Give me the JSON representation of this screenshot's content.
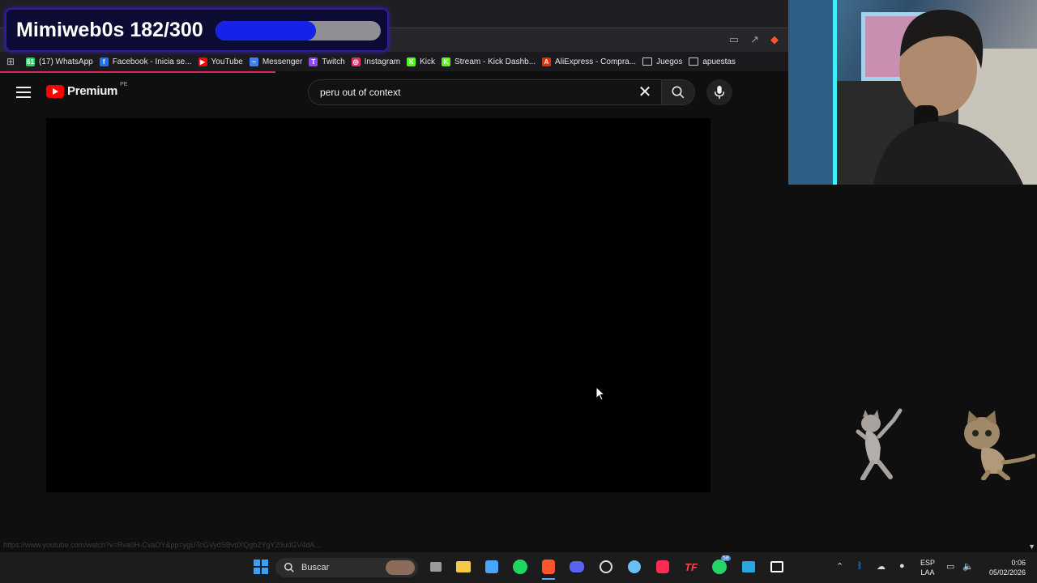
{
  "overlay": {
    "goal_text": "Mimiweb0s 182/300",
    "goal_progress": 0.607,
    "fill_color": "#1522e8"
  },
  "bookmarks": [
    {
      "label": "(17) WhatsApp",
      "icon": "whatsapp-icon",
      "color": "#25d366",
      "badge": "61"
    },
    {
      "label": "Facebook - Inicia se...",
      "icon": "facebook-icon",
      "color": "#1877f2",
      "badge": "f"
    },
    {
      "label": "YouTube",
      "icon": "youtube-icon",
      "color": "#ff0000",
      "badge": "▶"
    },
    {
      "label": "Messenger",
      "icon": "messenger-icon",
      "color": "#3b82f6",
      "badge": "~"
    },
    {
      "label": "Twitch",
      "icon": "twitch-icon",
      "color": "#9146ff",
      "badge": "T"
    },
    {
      "label": "Instagram",
      "icon": "instagram-icon",
      "color": "#e1306c",
      "badge": "◎"
    },
    {
      "label": "Kick",
      "icon": "kick-icon",
      "color": "#53fc18",
      "badge": "K"
    },
    {
      "label": "Stream - Kick Dashb...",
      "icon": "kick-icon",
      "color": "#53fc18",
      "badge": "K"
    },
    {
      "label": "AliExpress - Compra...",
      "icon": "aliexpress-icon",
      "color": "#e62e04",
      "badge": "A"
    },
    {
      "label": "Juegos",
      "icon": "folder-icon",
      "color": "#cfcfcf",
      "badge": ""
    },
    {
      "label": "apuestas",
      "icon": "folder-icon",
      "color": "#cfcfcf",
      "badge": ""
    }
  ],
  "youtube": {
    "brand": "Premium",
    "country": "PE",
    "search_value": "peru out of context",
    "clear_glyph": "✕"
  },
  "status_bar": {
    "url": "https://www.youtube.com/watch?v=Rva0H-CvaOY&pp=ygUTcGVydSBvdXQgb2YgY29udGV4dA..."
  },
  "taskbar": {
    "search_label": "Buscar",
    "lang_line1": "ESP",
    "lang_line2": "LAA",
    "time": "0:06",
    "date": "05/02/2026",
    "whatsapp_badge": "58"
  }
}
